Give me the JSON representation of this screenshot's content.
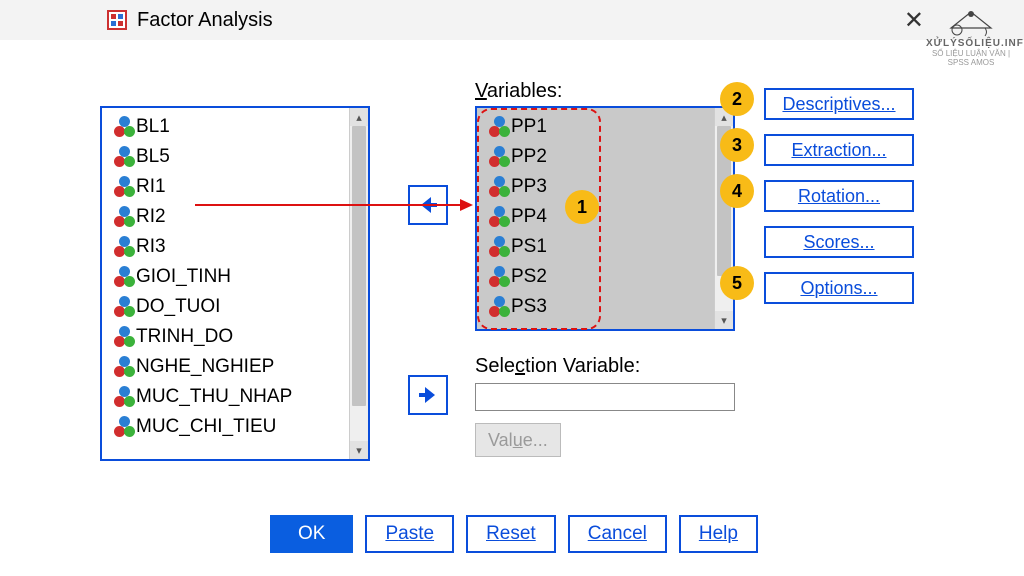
{
  "title": "Factor Analysis",
  "labels": {
    "variables": "Variables:",
    "variables_ul": "V",
    "selection": "Selection Variable:",
    "selection_ul": "c",
    "value": "Value...",
    "value_ul": "u"
  },
  "source_list": [
    "BL1",
    "BL5",
    "RI1",
    "RI2",
    "RI3",
    "GIOI_TINH",
    "DO_TUOI",
    "TRINH_DO",
    "NGHE_NGHIEP",
    "MUC_THU_NHAP",
    "MUC_CHI_TIEU"
  ],
  "selected_list": [
    "PP1",
    "PP2",
    "PP3",
    "PP4",
    "PS1",
    "PS2",
    "PS3"
  ],
  "side_buttons": [
    {
      "label": "Descriptives...",
      "ul": "D"
    },
    {
      "label": "Extraction...",
      "ul": "E"
    },
    {
      "label": "Rotation...",
      "ul": "t"
    },
    {
      "label": "Scores...",
      "ul": "S"
    },
    {
      "label": "Options...",
      "ul": "O"
    }
  ],
  "bottom_buttons": {
    "ok": "OK",
    "paste": "Paste",
    "paste_ul": "P",
    "reset": "Reset",
    "reset_ul": "R",
    "cancel": "Cancel",
    "help": "Help"
  },
  "badges": [
    "1",
    "2",
    "3",
    "4",
    "5"
  ],
  "watermark": {
    "big": "XỬLÝSỐLIỆU.INFO",
    "small": "SỐ LIỆU LUẬN VĂN | SPSS AMOS"
  }
}
